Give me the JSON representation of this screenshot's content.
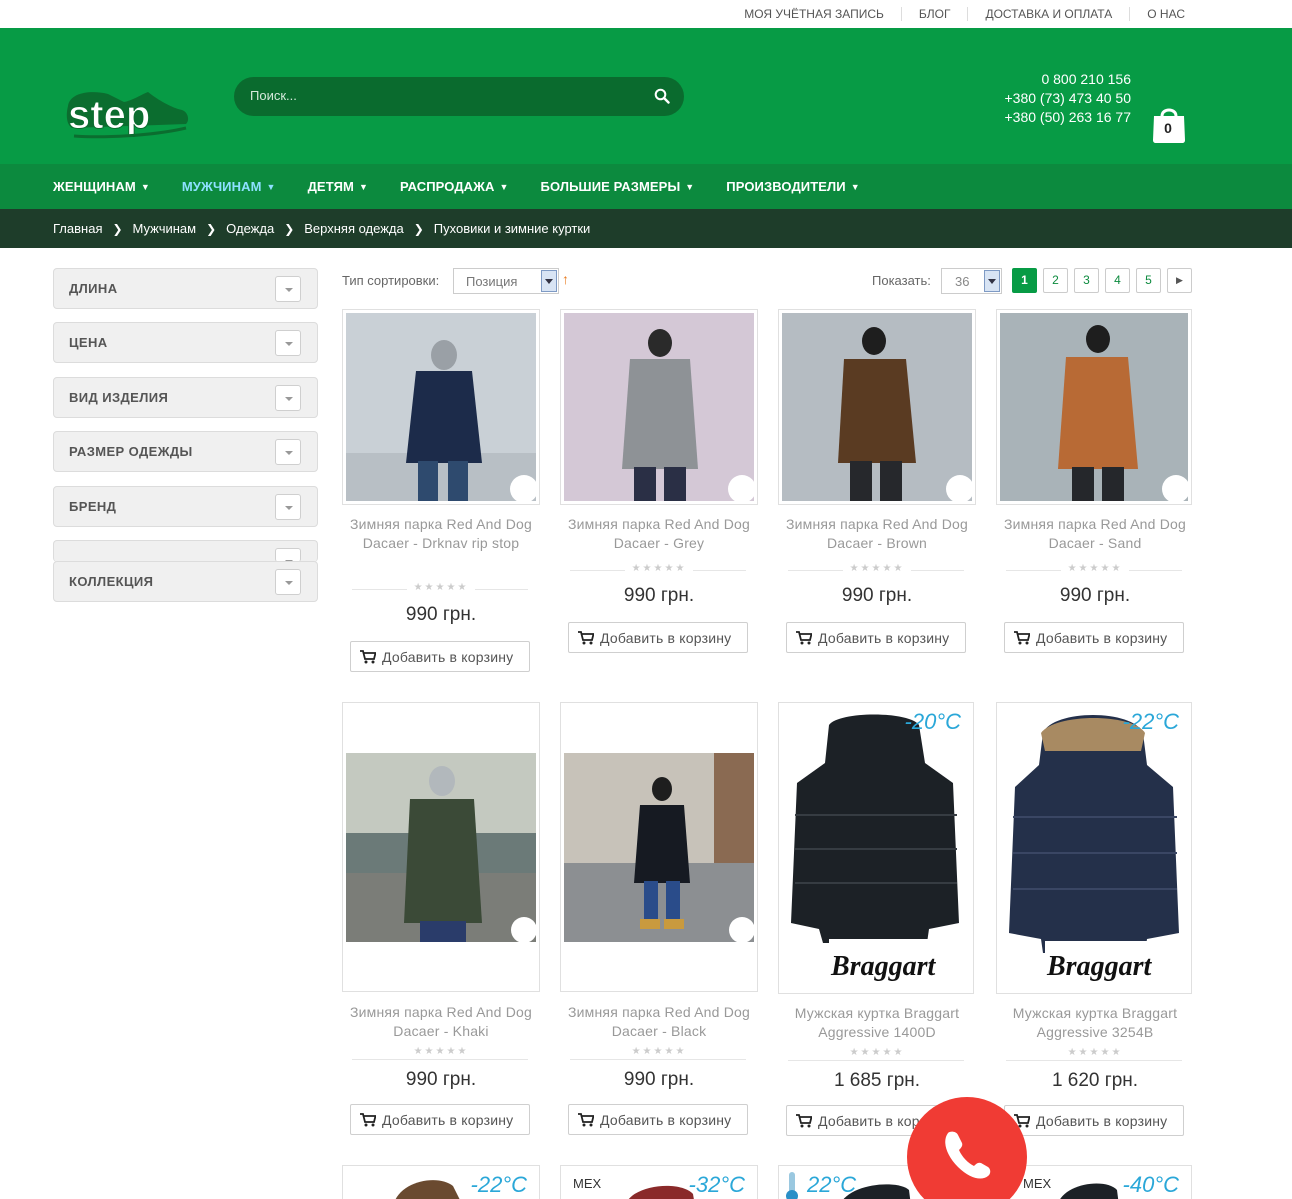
{
  "topbar": {
    "links": [
      "МОЯ УЧЁТНАЯ ЗАПИСЬ",
      "БЛОГ",
      "ДОСТАВКА И ОПЛАТА",
      "О НАС"
    ]
  },
  "header": {
    "logo_text": "step",
    "search_placeholder": "Поиск...",
    "phones": [
      "0 800 210 156",
      "+380 (73) 473 40 50",
      "+380 (50) 263 16 77"
    ],
    "cart_count": "0"
  },
  "nav": {
    "items": [
      {
        "label": "ЖЕНЩИНАМ"
      },
      {
        "label": "МУЖЧИНАМ"
      },
      {
        "label": "ДЕТЯМ"
      },
      {
        "label": "РАСПРОДАЖА"
      },
      {
        "label": "БОЛЬШИЕ РАЗМЕРЫ"
      },
      {
        "label": "ПРОИЗВОДИТЕЛИ"
      }
    ]
  },
  "breadcrumb": [
    "Главная",
    "Мужчинам",
    "Одежда",
    "Верхняя одежда",
    "Пуховики и зимние куртки"
  ],
  "filters": [
    "ДЛИНА",
    "ЦЕНА",
    "ВИД ИЗДЕЛИЯ",
    "РАЗМЕР ОДЕЖДЫ",
    "БРЕНД",
    "КОЛЛЕКЦИЯ"
  ],
  "toolbar": {
    "sort_label": "Тип сортировки:",
    "sort_value": "Позиция",
    "show_label": "Показать:",
    "show_value": "36",
    "pages": [
      "1",
      "2",
      "3",
      "4",
      "5"
    ]
  },
  "add_to_cart_label": "Добавить в корзину",
  "products": [
    {
      "name": "Зимняя парка Red And Dog Dacaer - Drknav rip stop",
      "price": "990 грн."
    },
    {
      "name": "Зимняя парка Red And Dog Dacaer - Grey",
      "price": "990 грн."
    },
    {
      "name": "Зимняя парка Red And Dog Dacaer - Brown",
      "price": "990 грн."
    },
    {
      "name": "Зимняя парка Red And Dog Dacaer - Sand",
      "price": "990 грн."
    },
    {
      "name": "Зимняя парка Red And Dog Dacaer - Khaki",
      "price": "990 грн."
    },
    {
      "name": "Зимняя парка Red And Dog Dacaer - Black",
      "price": "990 грн."
    },
    {
      "name": "Мужская куртка Braggart Aggressive 1400D",
      "price": "1 685 грн.",
      "temp": "-20°C"
    },
    {
      "name": "Мужская куртка Braggart Aggressive 3254B",
      "price": "1 620 грн.",
      "temp": "-22°C"
    }
  ],
  "partial_row_temps": [
    "-22°C",
    "-32°C",
    "22°C",
    "-40°C"
  ],
  "partial_row_labels": [
    "MEX",
    "MEX"
  ],
  "colors": {
    "header_green": "#079b45",
    "nav_green": "#0c8a3e",
    "breadcrumb_dark": "#1e3d2a",
    "call_button": "#f03b34",
    "accent_blue": "#8ee0ff"
  }
}
